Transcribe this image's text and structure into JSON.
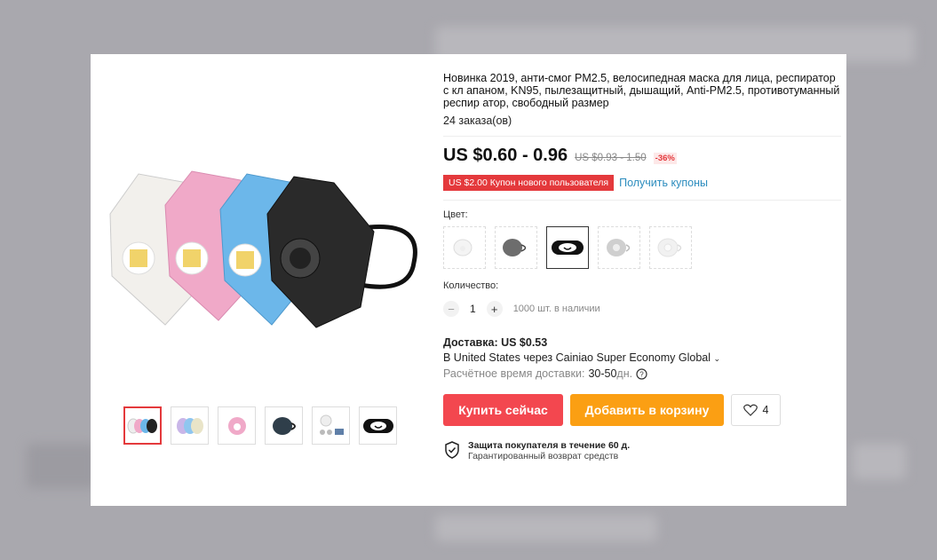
{
  "product": {
    "title": "Новинка 2019, анти-смог PM2.5, велосипедная маска для лица, респиратор с кл апаном, KN95, пылезащитный, дышащий, Anti-PM2.5, противотуманный респир атор, свободный размер",
    "orders": "24 заказа(ов)",
    "price": "US $0.60 - 0.96",
    "old_price": "US $0.93 - 1.50",
    "discount": "-36%",
    "coupon": "US $2.00 Купон нового пользователя",
    "coupon_link": "Получить купоны"
  },
  "color": {
    "label": "Цвет:",
    "options": [
      "white",
      "gray",
      "black-face",
      "light-gray",
      "pale"
    ],
    "selected_index": 2
  },
  "quantity": {
    "label": "Количество:",
    "value": "1",
    "minus": "−",
    "plus": "+",
    "stock": "1000 шт. в наличии"
  },
  "shipping": {
    "title": "Доставка: US $0.53",
    "via": "В United States через Cainiao Super Economy Global",
    "eta_label": "Расчётное время доставки:",
    "eta_value": "30-50",
    "eta_unit": "дн."
  },
  "actions": {
    "buy": "Купить сейчас",
    "cart": "Добавить в корзину",
    "wish_count": "4"
  },
  "protection": {
    "title": "Защита покупателя в течение 60 д.",
    "subtitle": "Гарантированный возврат средств"
  },
  "colors": {
    "accent": "#f3474f",
    "cart": "#fb9f13",
    "link": "#2b8cbe"
  }
}
